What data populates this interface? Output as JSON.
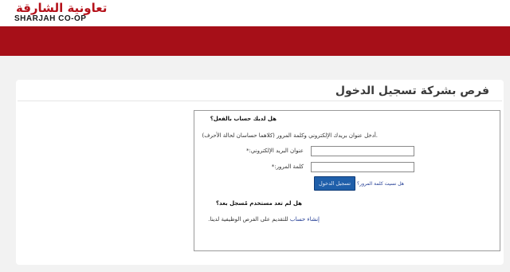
{
  "brand": {
    "name_ar": "تعاونية الشارقة",
    "name_en": "SHARJAH CO-OP",
    "accent_color": "#a60f18"
  },
  "page": {
    "title": "فرص بشركة تسجيل الدخول"
  },
  "login": {
    "heading": "هل لديك حساب بالفعل؟",
    "instructions": ".أدخل عنوان بريدك الإلكتروني وكلمة المرور (كلاهما حساسان لحالة الأحرف)",
    "email_label": "عنوان البريد الإلكتروني:*",
    "email_value": "",
    "password_label": "كلمة المرور:*",
    "password_value": "",
    "forgot_link": "هل نسيت كلمة المرور؟",
    "submit_label": "تسجيل الدخول"
  },
  "register": {
    "heading": "هل لم تعد مستخدم مُسجل بعد؟",
    "link_text": "إنشاء حساب",
    "text": "للتقديم على الفرص الوظيفية لدينا."
  }
}
